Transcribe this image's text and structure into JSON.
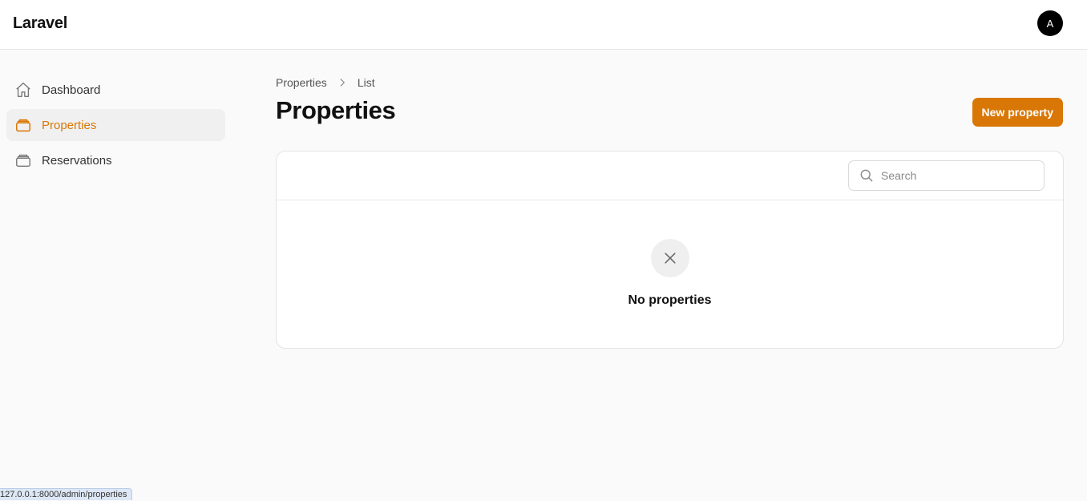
{
  "app": {
    "brand": "Laravel",
    "avatar_initial": "A"
  },
  "sidebar": {
    "items": [
      {
        "label": "Dashboard",
        "icon": "home-icon",
        "active": false
      },
      {
        "label": "Properties",
        "icon": "stack-icon",
        "active": true
      },
      {
        "label": "Reservations",
        "icon": "stack-icon",
        "active": false
      }
    ]
  },
  "breadcrumb": {
    "items": [
      "Properties",
      "List"
    ]
  },
  "page": {
    "title": "Properties",
    "new_button_label": "New property"
  },
  "table": {
    "search_placeholder": "Search",
    "search_value": "",
    "empty_text": "No properties"
  },
  "status_bar": {
    "url": "127.0.0.1:8000/admin/properties"
  },
  "colors": {
    "accent": "#d97706",
    "background": "#fafafa",
    "surface": "#ffffff"
  }
}
